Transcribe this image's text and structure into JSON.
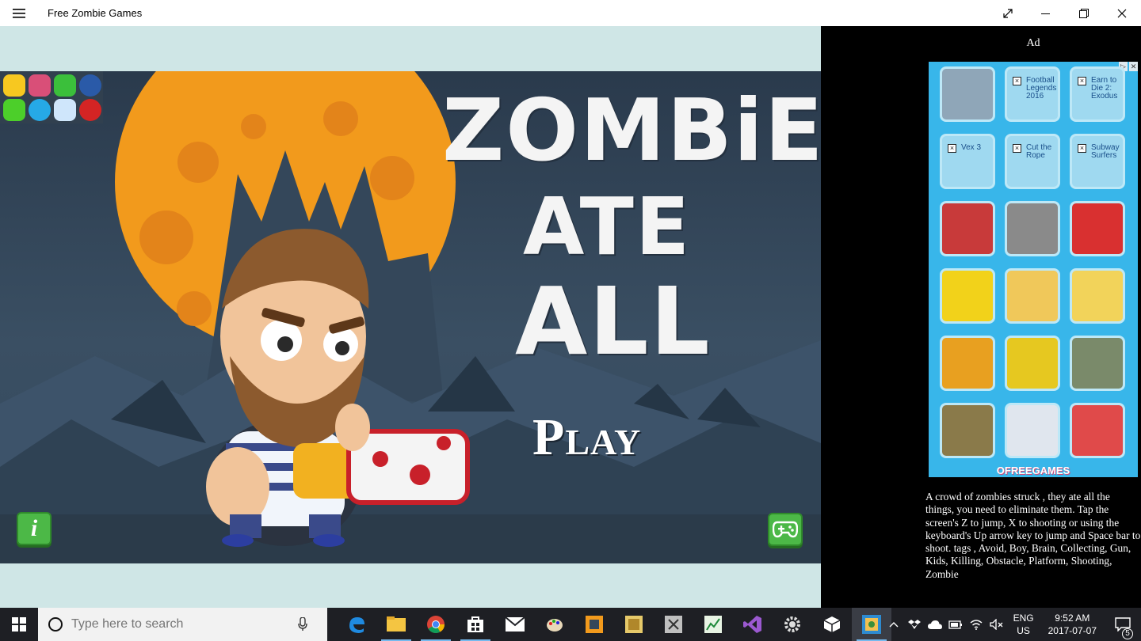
{
  "window": {
    "title": "Free Zombie Games"
  },
  "game": {
    "title_line1": "ZOMBiES",
    "title_line2": "ATE",
    "title_line3": "ALL",
    "play_label": "Play",
    "info_glyph": "i"
  },
  "ad": {
    "label": "Ad",
    "close_glyphs": [
      "▷",
      "✕"
    ],
    "tiles": [
      {
        "label": "",
        "image": true
      },
      {
        "label": "Football Legends 2016"
      },
      {
        "label": "Earn to Die 2: Exodus"
      },
      {
        "label": "Vex 3"
      },
      {
        "label": "Cut the Rope"
      },
      {
        "label": "Subway Surfers"
      },
      {
        "label": "",
        "image": true
      },
      {
        "label": "",
        "image": true
      },
      {
        "label": "",
        "image": true
      },
      {
        "label": "",
        "image": true
      },
      {
        "label": "",
        "image": true
      },
      {
        "label": "",
        "image": true
      },
      {
        "label": "",
        "image": true
      },
      {
        "label": "",
        "image": true
      },
      {
        "label": "",
        "image": true
      },
      {
        "label": "",
        "image": true
      },
      {
        "label": "",
        "image": true
      },
      {
        "label": "",
        "image": true
      }
    ],
    "brand": "OFREEGAMES"
  },
  "description": "A crowd of zombies struck , they ate all the things, you need to eliminate them. Tap the screen's Z to jump, X to shooting or using the keyboard's Up arrow key to jump and Space bar to shoot. tags , Avoid, Boy, Brain, Collecting, Gun, Kids, Killing, Obstacle, Platform, Shooting, Zombie",
  "taskbar": {
    "search_placeholder": "Type here to search",
    "lang_line1": "ENG",
    "lang_line2": "US",
    "time": "9:52 AM",
    "date": "2017-07-07",
    "notification_count": "5"
  },
  "colors": {
    "moon": "#f29a1c",
    "ad_bg": "#38b6ea",
    "play_green": "#4cb847"
  }
}
